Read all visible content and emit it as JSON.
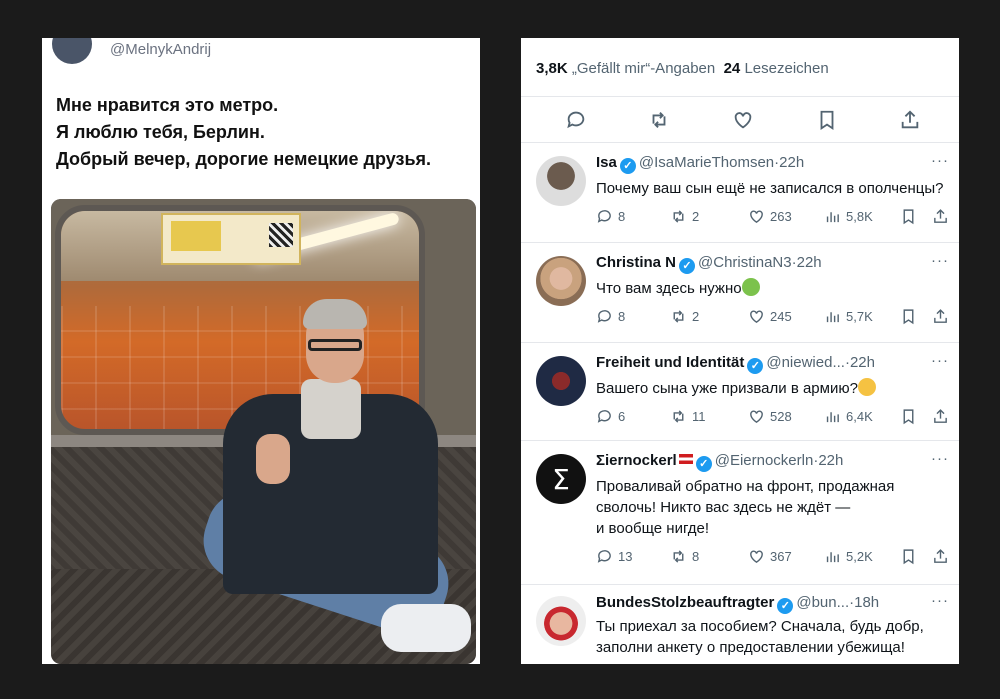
{
  "left": {
    "handle": "@MelnykAndrij",
    "lines": [
      "Мне нравится это метро.",
      "Я люблю тебя, Берлин.",
      "Добрый вечер, дорогие немецкие друзья."
    ]
  },
  "right": {
    "likes_count": "3,8K",
    "likes_label": "„Gefällt mir“-Angaben",
    "bookmarks_count": "24",
    "bookmarks_label": "Lesezeichen",
    "action_icons": [
      "reply-icon",
      "retweet-icon",
      "like-icon",
      "bookmark-icon",
      "share-icon"
    ],
    "replies": [
      {
        "name": "Isa",
        "handle": "@IsaMarieThomsen",
        "sep": "·",
        "time": "22h",
        "text": "Почему ваш сын ещё не записался в ополченцы?",
        "replies": "8",
        "retweets": "2",
        "likes": "263",
        "views": "5,8K"
      },
      {
        "name": "Christina N",
        "handle": "@ChristinaN3",
        "sep": "·",
        "time": "22h",
        "text": "Что вам здесь нужно",
        "emoji": "nauseated-face",
        "replies": "8",
        "retweets": "2",
        "likes": "245",
        "views": "5,7K"
      },
      {
        "name": "Freiheit und Identität",
        "handle": "@niewied...",
        "sep": "·",
        "time": "22h",
        "text": "Вашего сына уже призвали в армию?",
        "emoji": "thinking-face",
        "replies": "6",
        "retweets": "11",
        "likes": "528",
        "views": "6,4K"
      },
      {
        "name": "Σiernockerl",
        "handle": "@Eiernockerln",
        "sep": "·",
        "time": "22h",
        "text_lines": [
          "Проваливай обратно на фронт, продажная",
          "сволочь! Никто вас здесь не ждёт —",
          "и вообще нигде!"
        ],
        "replies": "13",
        "retweets": "8",
        "likes": "367",
        "views": "5,2K"
      },
      {
        "name": "BundesStolzbeauftragter",
        "handle": "@bun...",
        "sep": "·",
        "time": "18h",
        "text_lines": [
          "Ты приехал за пособием? Сначала, будь добр,",
          "заполни анкету о предоставлении убежища!"
        ]
      }
    ]
  },
  "colors": {
    "background": "#1b1b1b",
    "verified": "#1d9bf0",
    "muted": "#536471"
  }
}
